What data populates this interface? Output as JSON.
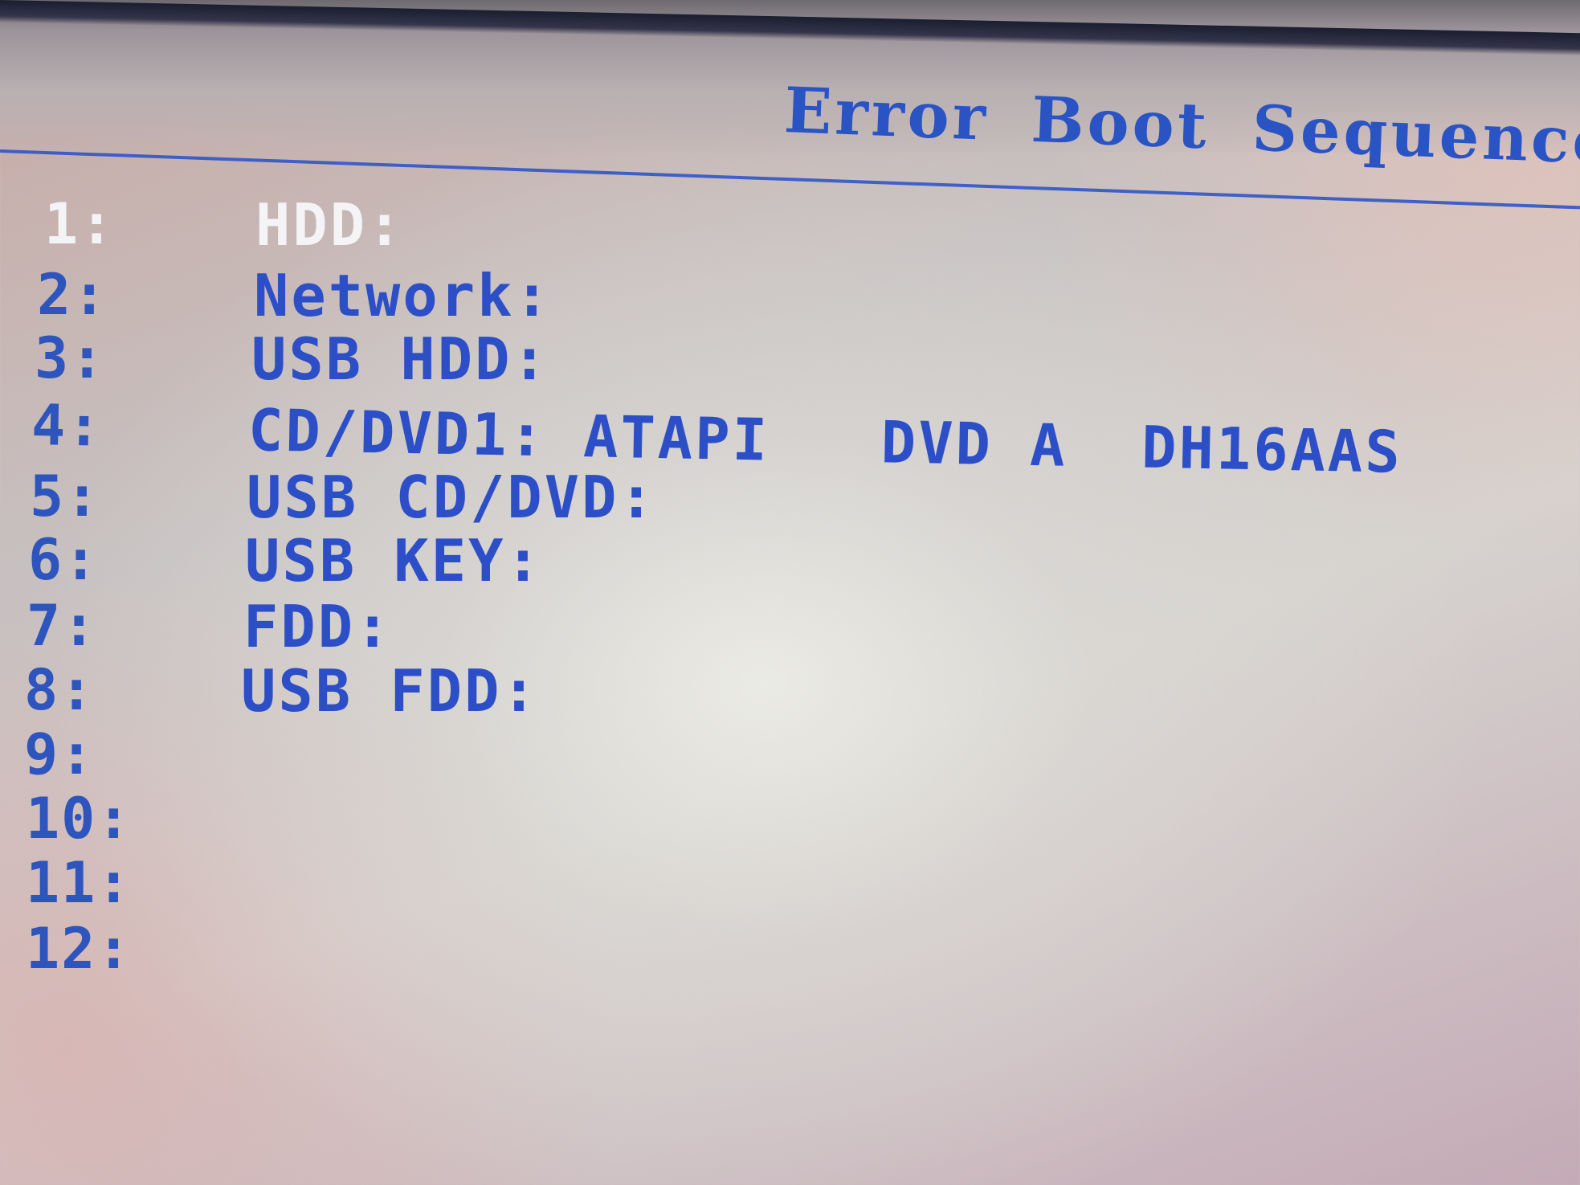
{
  "screen": {
    "title": "Error Boot Sequence",
    "accent_color": "#2c4fc8",
    "selected_color": "#f4f3f6"
  },
  "boot_sequence": [
    {
      "index": "1:",
      "device": "HDD:"
    },
    {
      "index": "2:",
      "device": "Network:"
    },
    {
      "index": "3:",
      "device": "USB HDD:"
    },
    {
      "index": "4:",
      "device": "CD/DVD1: ATAPI   DVD A  DH16AAS"
    },
    {
      "index": "5:",
      "device": "USB CD/DVD:"
    },
    {
      "index": "6:",
      "device": "USB KEY:"
    },
    {
      "index": "7:",
      "device": "FDD:"
    },
    {
      "index": "8:",
      "device": "USB FDD:"
    },
    {
      "index": "9:",
      "device": ""
    },
    {
      "index": "10:",
      "device": ""
    },
    {
      "index": "11:",
      "device": ""
    },
    {
      "index": "12:",
      "device": ""
    }
  ]
}
